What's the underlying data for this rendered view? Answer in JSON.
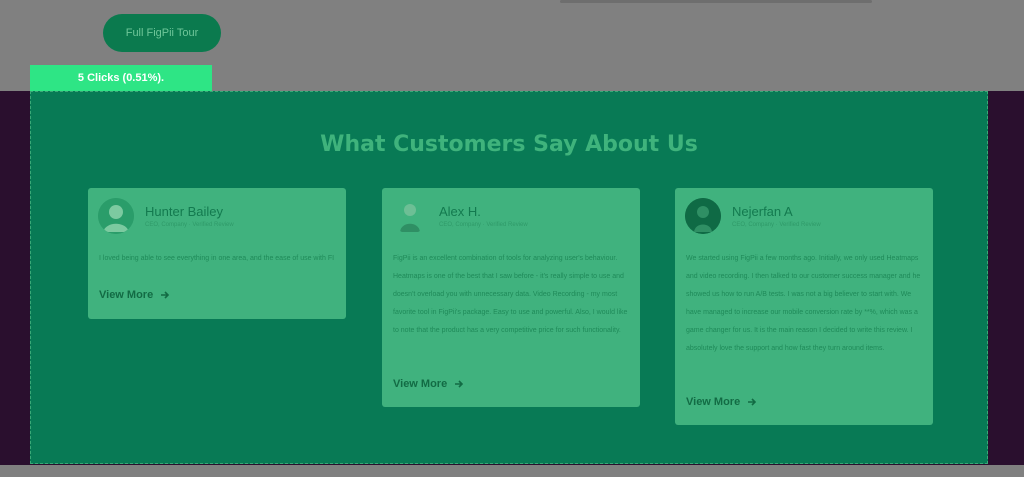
{
  "top": {
    "tour_button": "Full FigPii Tour",
    "clicks_badge": "5 Clicks (0.51%)."
  },
  "section": {
    "title": "What Customers Say About Us"
  },
  "testimonials": [
    {
      "name": "Hunter Bailey",
      "role": "CEO, Company · Verified Review",
      "text": "I loved being able to see everything in one area, and the ease of use with FI",
      "cta": "View More"
    },
    {
      "name": "Alex H.",
      "role": "CEO, Company · Verified Review",
      "text": "FigPii is an excellent combination of tools for analyzing user's behaviour. Heatmaps is one of the best that I saw before - it's really simple to use and doesn't overload you with unnecessary data. Video Recording - my most favorite tool in FigPii's package. Easy to use and powerful. Also, I would like to note that the product has a very competitive price for such functionality.",
      "cta": "View More"
    },
    {
      "name": "Nejerfan A",
      "role": "CEO, Company · Verified Review",
      "text": "We started using FigPii a few months ago. Initially, we only used Heatmaps and video recording. I then talked to our customer success manager and he showed us how to run A/B tests. I was not a big believer to start with. We have managed to increase our mobile conversion rate by **%, which was a game changer for us. It is the main reason I decided to write this review. I absolutely love the support and how fast they turn around items.",
      "cta": "View More"
    }
  ],
  "colors": {
    "overlay_green": "#087a55",
    "card_green": "#40b27e",
    "badge_green": "#2ee585",
    "dark_purple": "#2a0f2e"
  },
  "icons": {
    "arrow": "arrow-right-icon"
  }
}
